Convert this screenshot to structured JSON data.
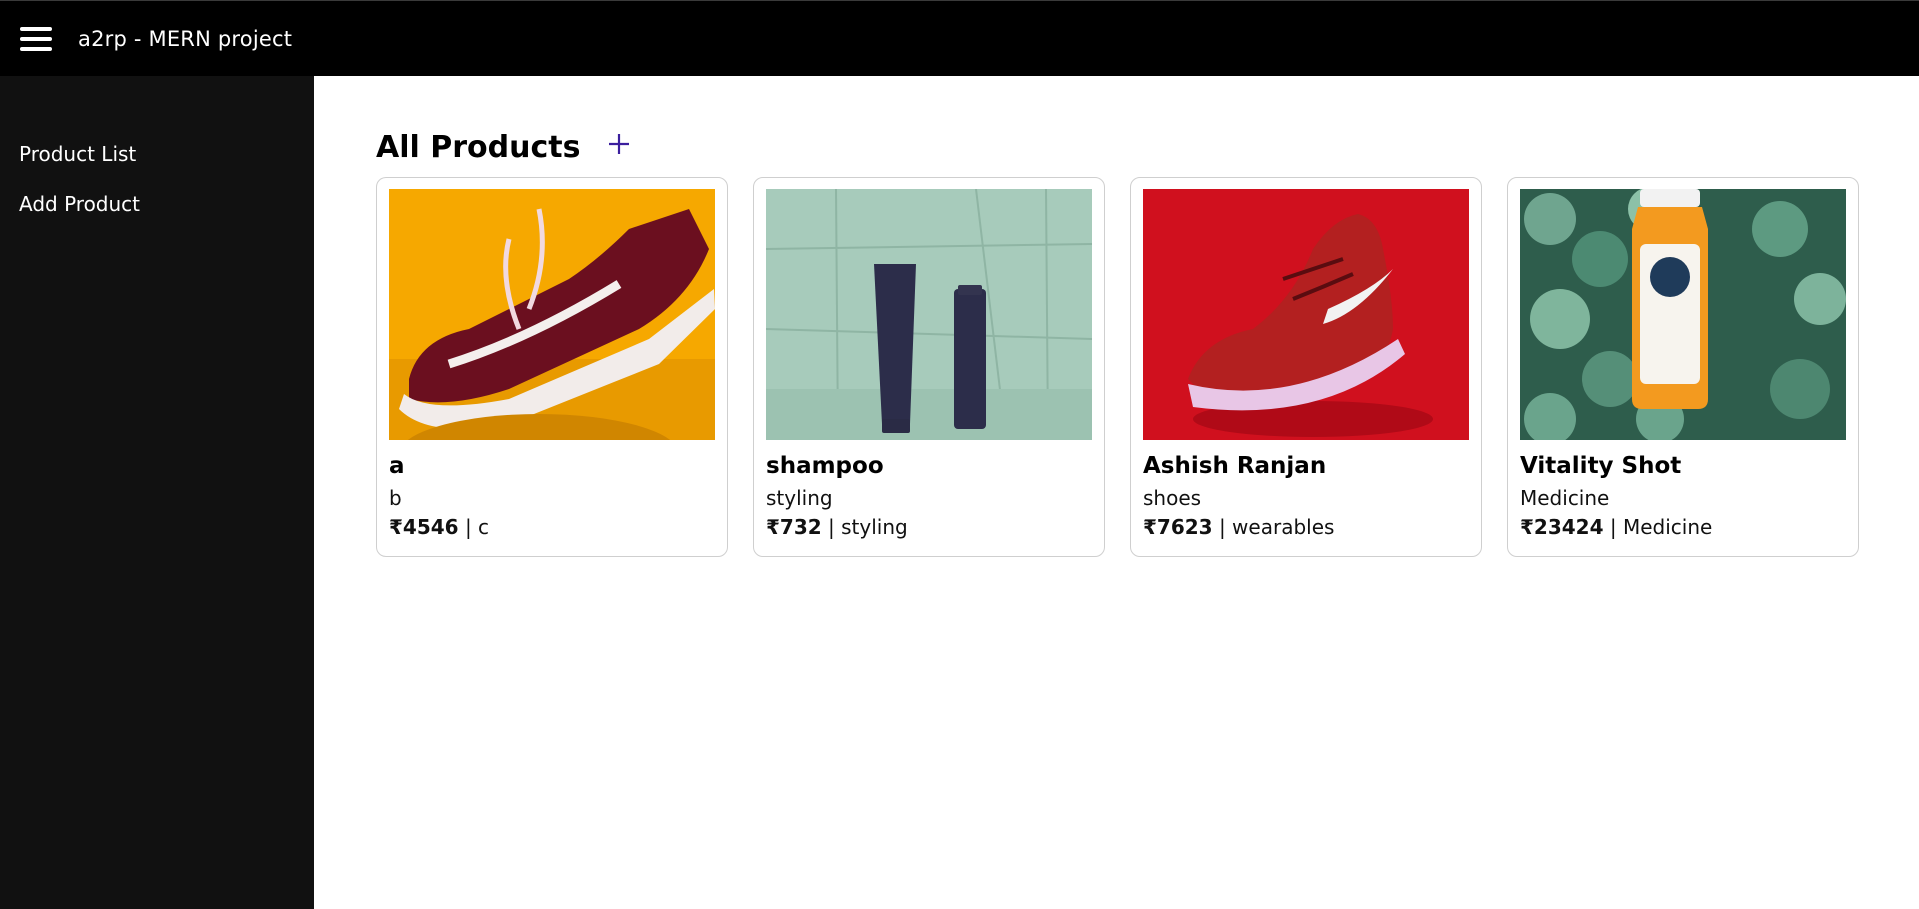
{
  "header": {
    "menu_icon": "hamburger-menu-icon",
    "title": "a2rp - MERN project"
  },
  "sidebar": {
    "items": [
      {
        "label": "Product List"
      },
      {
        "label": "Add Product"
      }
    ]
  },
  "main": {
    "title": "All Products",
    "add_icon": "plus-icon",
    "add_icon_color": "#3b1f9e",
    "products": [
      {
        "name": "a",
        "subtitle": "b",
        "price": "₹4546",
        "separator": " | ",
        "category": "c",
        "image_icon": "sneaker-image"
      },
      {
        "name": "shampoo",
        "subtitle": "styling",
        "price": "₹732",
        "separator": " | ",
        "category": "styling",
        "image_icon": "shampoo-bottles-image"
      },
      {
        "name": "Ashish Ranjan",
        "subtitle": "shoes",
        "price": "₹7623",
        "separator": " | ",
        "category": "wearables",
        "image_icon": "running-shoe-image"
      },
      {
        "name": "Vitality Shot",
        "subtitle": "Medicine",
        "price": "₹23424",
        "separator": " | ",
        "category": "Medicine",
        "image_icon": "juice-bottle-image"
      }
    ]
  },
  "colors": {
    "topbar_bg": "#000000",
    "sidebar_bg": "#111111",
    "card_border": "#cfcfcf"
  }
}
